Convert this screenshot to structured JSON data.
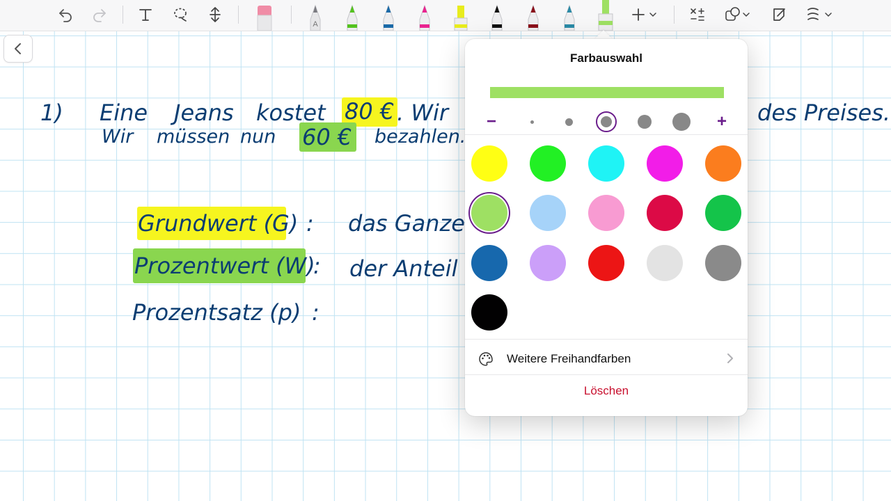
{
  "toolbar": {
    "tools": [
      "undo-icon",
      "redo-icon",
      "text-tool-icon",
      "lasso-tool-icon",
      "insert-space-icon"
    ],
    "pens": [
      {
        "name": "eraser",
        "color": "#f08ca6"
      },
      {
        "name": "pencil",
        "color": "#9a9aa0",
        "label": "A"
      },
      {
        "name": "green-pen",
        "color": "#54c21f"
      },
      {
        "name": "blue-pen",
        "color": "#1a6aa8"
      },
      {
        "name": "magenta-pen",
        "color": "#e9228f"
      },
      {
        "name": "yellow-highlighter",
        "color": "#e8ec1d"
      },
      {
        "name": "black-pen",
        "color": "#111111"
      },
      {
        "name": "dark-red-pen",
        "color": "#8a0f1a"
      },
      {
        "name": "teal-pen",
        "color": "#2a8aa6"
      },
      {
        "name": "green-highlighter",
        "color": "#9ee063",
        "active": true
      }
    ]
  },
  "canvas": {
    "lines": {
      "l1_num": "1)",
      "l1_a": "Eine",
      "l1_b": "Jeans",
      "l1_c": "kostet",
      "l1_price": "80 €",
      "l1_d": ". Wir",
      "l1_end": "des Preises.",
      "l2_a": "Wir",
      "l2_b": "müssen",
      "l2_c": "nun",
      "l2_price": "60 €",
      "l2_d": "bezahlen.",
      "def1_term": "Grundwert (G)",
      "def1_colon": ":",
      "def1_def": "das Ganze",
      "def2_term": "Prozentwert (W)",
      "def2_colon": ":",
      "def2_def": "der Anteil",
      "def3_term": "Prozentsatz (p)",
      "def3_colon": ":"
    }
  },
  "popover": {
    "title": "Farbauswahl",
    "preview_color": "#9ee063",
    "size_minus": "−",
    "size_plus": "+",
    "selected_size_index": 2,
    "colors": [
      "#ffff14",
      "#22f024",
      "#1ff3f5",
      "#f21de8",
      "#fb7d1e",
      "#9ee063",
      "#a6d3f9",
      "#f89bd2",
      "#dc0a46",
      "#14c44a",
      "#1768ad",
      "#cb9ff9",
      "#ec1515",
      "#e3e3e3",
      "#8a8a8a",
      "#020102"
    ],
    "selected_color_index": 5,
    "more_colors_label": "Weitere Freihandfarben",
    "delete_label": "Löschen"
  }
}
